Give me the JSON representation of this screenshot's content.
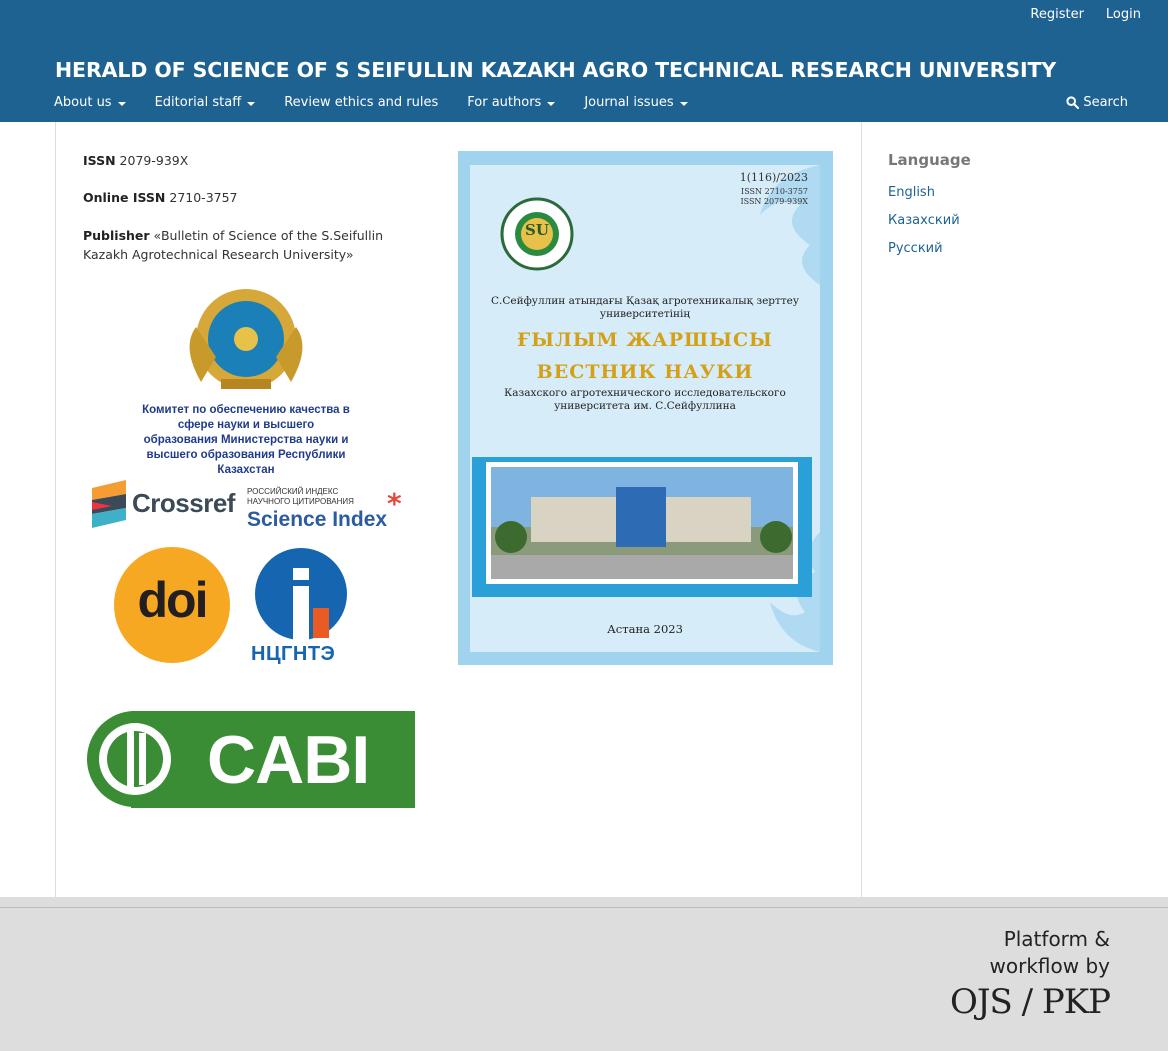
{
  "user_nav": {
    "register": "Register",
    "login": "Login"
  },
  "site_title": "HERALD OF SCIENCE OF S SEIFULLIN KAZAKH AGRO TECHNICAL RESEARCH UNIVERSITY",
  "primary_nav": {
    "about": "About us",
    "editorial": "Editorial staff",
    "review": "Review ethics and rules",
    "authors": "For authors",
    "issues": "Journal issues",
    "search": "Search"
  },
  "info": {
    "issn_label": "ISSN",
    "issn_value": "2079-939X",
    "online_issn_label": "Online ISSN",
    "online_issn_value": "2710-3757",
    "publisher_label": "Publisher",
    "publisher_value": "«Bulletin of Science of the S.Seifullin Kazakh Agrotechnical Research University»"
  },
  "logos": {
    "committee_text": "Комитет по обеспечению качества в сфере науки и высшего образования Министерства науки и высшего образования Республики Казахстан",
    "crossref": "Crossref",
    "rsci_small": "РОССИЙСКИЙ ИНДЕКС НАУЧНОГО ЦИТИРОВАНИЯ",
    "rsci_big": "Science Index",
    "doi": "doi",
    "ncgnte": "НЦГНТЭ",
    "cabi": "CABI"
  },
  "cover": {
    "issue": "1(116)/2023",
    "issn1": "ISSN 2710-3757",
    "issn2": "ISSN 2079-939X",
    "kz_line": "С.Сейфуллин атындағы Қазақ агротехникалық зерттеу университетінің",
    "kz_title": "ҒЫЛЫМ ЖАРШЫСЫ",
    "ru_title": "ВЕСТНИК НАУКИ",
    "ru_line": "Казахского агротехнического исследовательского университета им. С.Сейфуллина",
    "city": "Астана 2023",
    "emblem": "SU"
  },
  "sidebar": {
    "title": "Language",
    "languages": [
      "English",
      "Казахский",
      "Русский"
    ]
  },
  "footer": {
    "line1": "Platform &",
    "line2": "workflow by",
    "line3": "OJS / PKP"
  },
  "colors": {
    "header": "#1e6292",
    "link": "#1e6292",
    "footer": "#dddddd",
    "cabi_green": "#3a8d35",
    "doi_orange": "#f7a823"
  }
}
